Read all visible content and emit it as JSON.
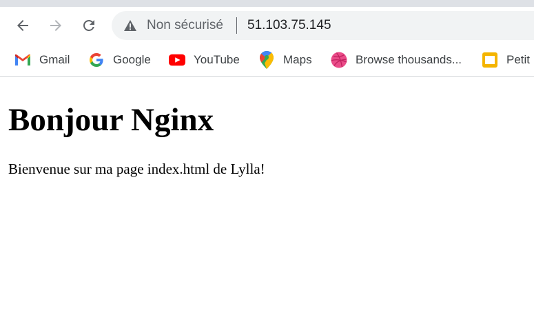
{
  "browser": {
    "security_label": "Non sécurisé",
    "url": "51.103.75.145",
    "nav": [
      {
        "name": "back-icon"
      },
      {
        "name": "forward-icon"
      },
      {
        "name": "reload-icon"
      }
    ],
    "bookmarks": [
      {
        "label": "Gmail",
        "icon": "gmail-icon"
      },
      {
        "label": "Google",
        "icon": "google-icon"
      },
      {
        "label": "YouTube",
        "icon": "youtube-icon"
      },
      {
        "label": "Maps",
        "icon": "maps-icon"
      },
      {
        "label": "Browse thousands...",
        "icon": "dribbble-icon"
      },
      {
        "label": "Petit",
        "icon": "slides-icon"
      }
    ]
  },
  "page": {
    "heading": "Bonjour Nginx",
    "paragraph": "Bienvenue sur ma page index.html de Lylla!"
  }
}
